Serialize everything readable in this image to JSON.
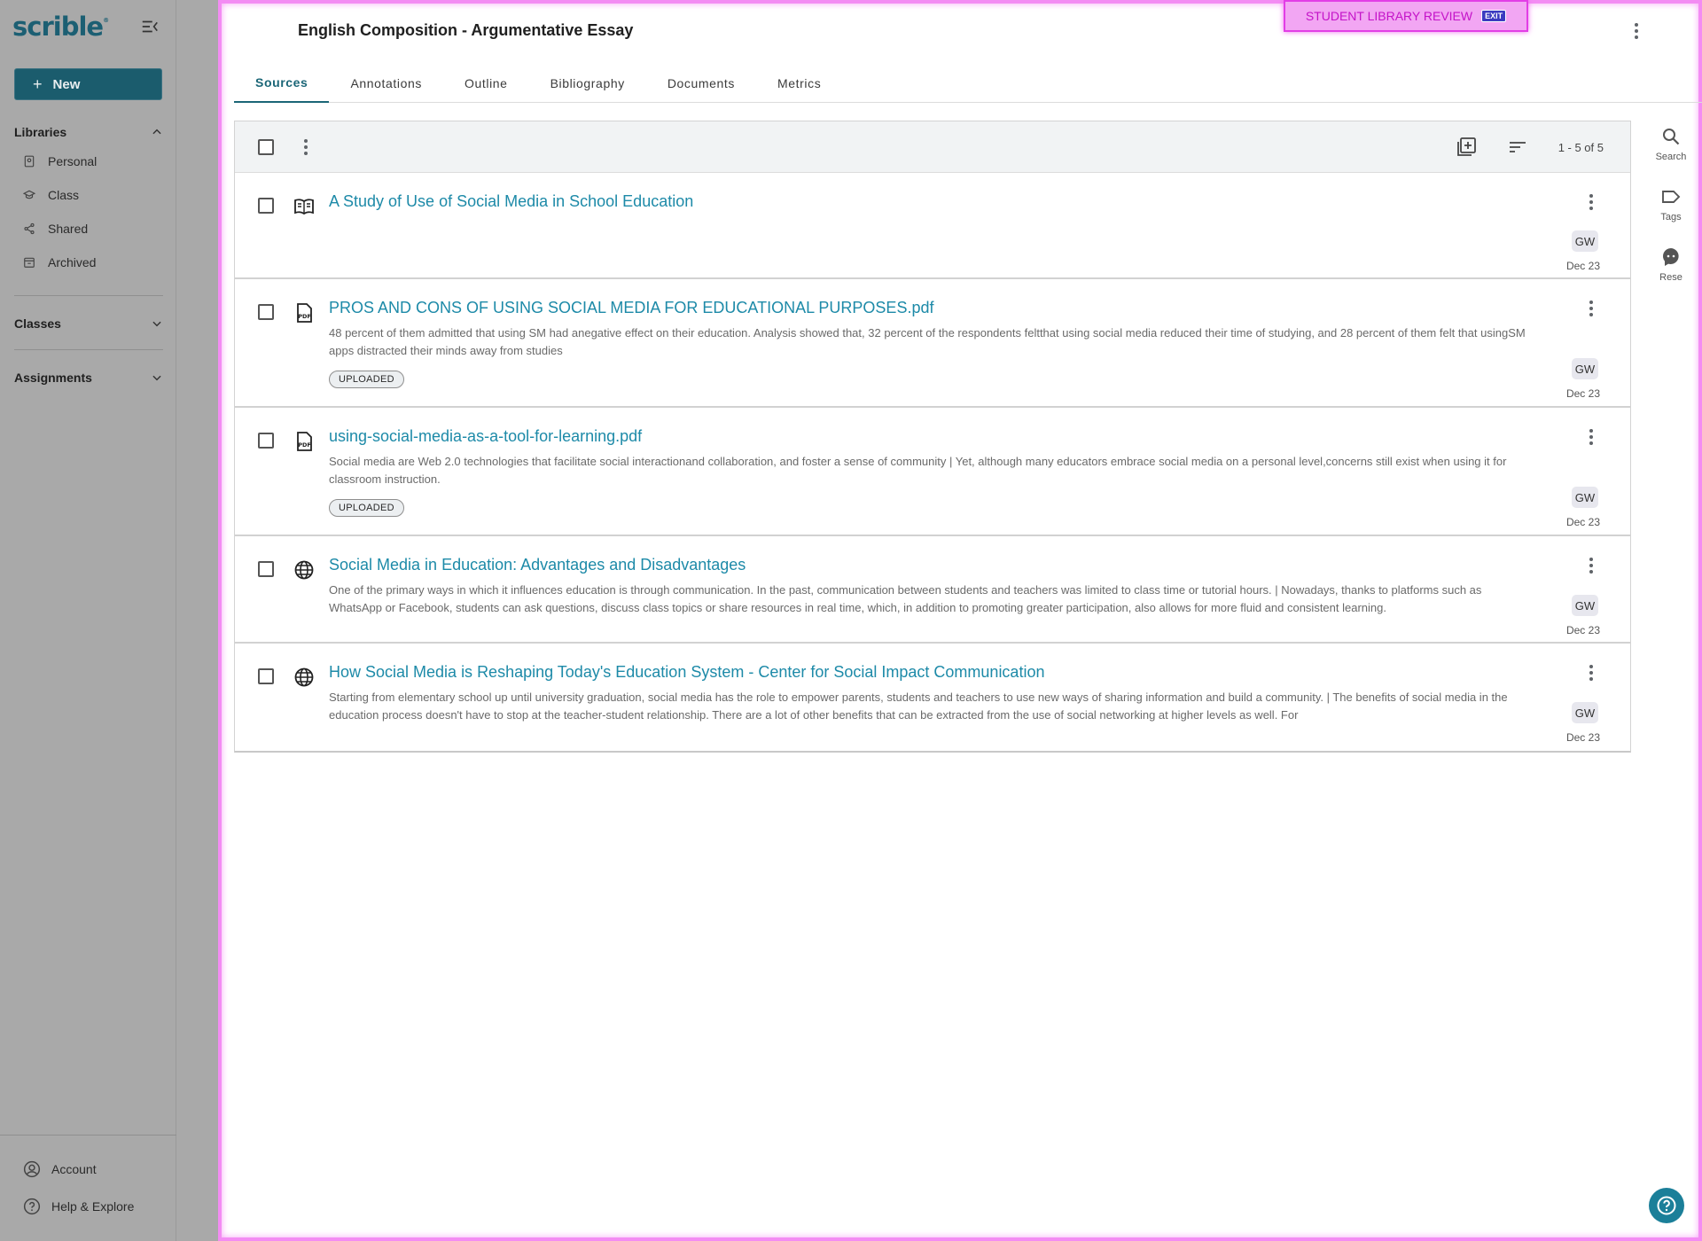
{
  "app": {
    "logo": "scrible",
    "logo_mark": "®"
  },
  "sidebar": {
    "new_label": "New",
    "libraries": {
      "heading": "Libraries",
      "items": [
        {
          "label": "Personal",
          "icon": "book-icon"
        },
        {
          "label": "Class",
          "icon": "graduation-cap-icon"
        },
        {
          "label": "Shared",
          "icon": "share-icon"
        },
        {
          "label": "Archived",
          "icon": "archive-icon"
        }
      ]
    },
    "classes_heading": "Classes",
    "assignments_heading": "Assignments",
    "bottom": {
      "account": "Account",
      "help": "Help & Explore"
    }
  },
  "header": {
    "title": "English Composition - Argumentative Essay",
    "banner": "STUDENT LIBRARY REVIEW",
    "banner_badge": "EXIT"
  },
  "tabs": [
    {
      "label": "Sources",
      "active": true
    },
    {
      "label": "Annotations",
      "active": false
    },
    {
      "label": "Outline",
      "active": false
    },
    {
      "label": "Bibliography",
      "active": false
    },
    {
      "label": "Documents",
      "active": false
    },
    {
      "label": "Metrics",
      "active": false
    }
  ],
  "toolbar": {
    "range": "1 - 5 of 5"
  },
  "sources": [
    {
      "type": "book",
      "title": "A Study of Use of Social Media in School Education",
      "snippet": "",
      "chip": "",
      "owner": "GW",
      "date": "Dec 23"
    },
    {
      "type": "pdf",
      "title": "PROS AND CONS OF USING SOCIAL MEDIA FOR EDUCATIONAL PURPOSES.pdf",
      "snippet": "48 percent of them admitted that using SM had anegative effect on their education. Analysis showed that, 32 percent of the respondents feltthat using social media reduced their time of studying, and 28 percent of them felt that usingSM apps distracted their minds away from studies",
      "chip": "UPLOADED",
      "owner": "GW",
      "date": "Dec 23"
    },
    {
      "type": "pdf",
      "title": "using-social-media-as-a-tool-for-learning.pdf",
      "snippet": "Social media are Web 2.0 technologies that facilitate social interactionand collaboration, and foster a sense of community | Yet, although many educators embrace social media on a personal level,concerns still exist when using it for classroom instruction.",
      "chip": "UPLOADED",
      "owner": "GW",
      "date": "Dec 23"
    },
    {
      "type": "web",
      "title": "Social Media in Education: Advantages and Disadvantages",
      "snippet": "One of the primary ways in which it influences education is through communication. In the past, communication between students and teachers was limited to class time or tutorial hours. | Nowadays, thanks to platforms such as WhatsApp or Facebook, students can ask questions, discuss class topics or share resources in real time, which, in addition to promoting greater participation, also allows for more fluid and consistent learning.",
      "chip": "",
      "owner": "GW",
      "date": "Dec 23"
    },
    {
      "type": "web",
      "title": "How Social Media is Reshaping Today's Education System - Center for Social Impact Communication",
      "snippet": "Starting from elementary school up until university graduation, social media has the role to empower parents, students and teachers to use new ways of sharing information and build a community.  | The benefits of social media in the education process doesn't have to stop at the teacher-student relationship. There are a lot of other benefits that can be extracted from the use of social networking at higher levels as well. For",
      "chip": "",
      "owner": "GW",
      "date": "Dec 23"
    }
  ],
  "rail": [
    {
      "label": "Search",
      "icon": "search-icon"
    },
    {
      "label": "Tags",
      "icon": "tag-icon"
    },
    {
      "label": "Rese",
      "icon": "research-chat-icon"
    }
  ]
}
